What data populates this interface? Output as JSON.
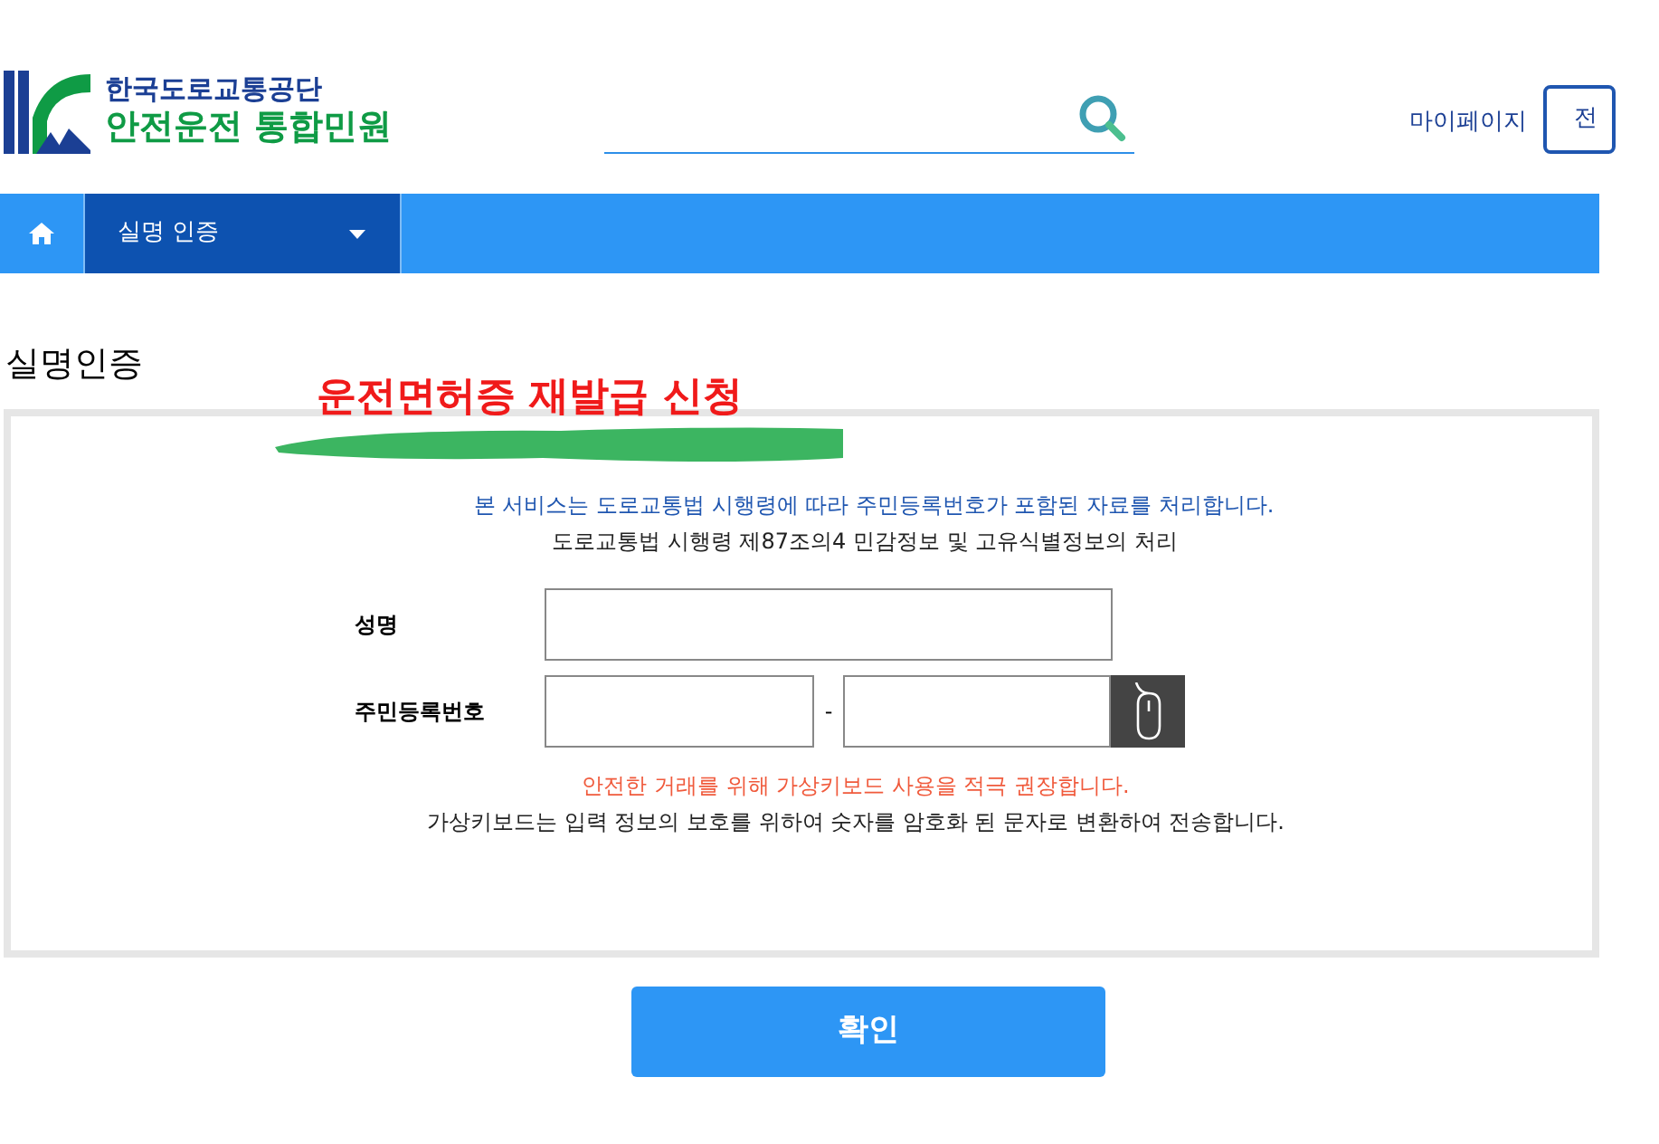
{
  "header": {
    "org_name": "한국도로교통공단",
    "service_name": "안전운전 통합민원",
    "mypage_link": "마이페이지",
    "cut_button": "전"
  },
  "nav": {
    "current": "실명 인증"
  },
  "page_title": "실명인증",
  "annotation": "운전면허증 재발급 신청",
  "notice": {
    "primary": "본 서비스는 도로교통법 시행령에 따라 주민등록번호가 포함된 자료를 처리합니다.",
    "secondary": "도로교통법 시행령 제87조의4 민감정보 및 고유식별정보의 처리"
  },
  "form": {
    "name_label": "성명",
    "rrn_label": "주민등록번호",
    "rrn_separator": "-"
  },
  "keyboard_notice": {
    "warning": "안전한 거래를 위해 가상키보드 사용을 적극 권장합니다.",
    "info": "가상키보드는 입력 정보의 보호를 위하여 숫자를 암호화 된 문자로 변환하여 전송합니다."
  },
  "confirm_button": "확인"
}
